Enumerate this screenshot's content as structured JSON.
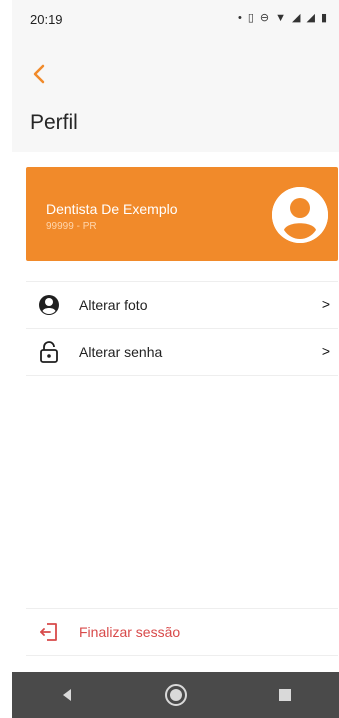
{
  "status_bar": {
    "time": "20:19",
    "icons": [
      "dot",
      "vibrate-icon",
      "do-not-disturb-icon",
      "wifi-icon",
      "signal-icon",
      "signal-icon",
      "battery-icon"
    ]
  },
  "header": {
    "back_icon": "chevron-left-icon",
    "title": "Perfil"
  },
  "profile": {
    "name": "Dentista De Exemplo",
    "registration": "99999 - PR",
    "avatar_icon": "user-circle-icon"
  },
  "menu": {
    "items": [
      {
        "label": "Alterar foto",
        "icon": "account-circle-icon",
        "chevron": ">"
      },
      {
        "label": "Alterar senha",
        "icon": "unlock-icon",
        "chevron": ">"
      }
    ]
  },
  "logout": {
    "label": "Finalizar sessão",
    "icon": "logout-icon"
  },
  "colors": {
    "accent": "#f18a2a",
    "logout": "#d84a4a",
    "navbar": "#4a4a4a"
  },
  "navbar": {
    "buttons": [
      "back-icon",
      "home-icon",
      "recent-apps-icon"
    ]
  }
}
